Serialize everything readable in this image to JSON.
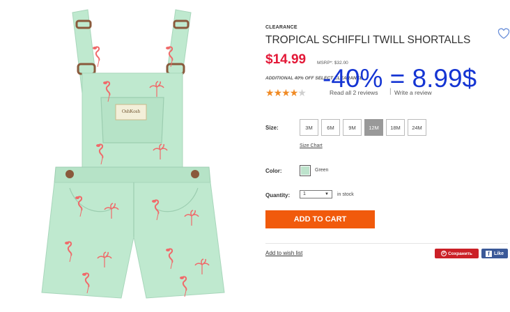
{
  "product": {
    "badge": "CLEARANCE",
    "title": "TROPICAL SCHIFFLI TWILL SHORTALLS",
    "price": "$14.99",
    "msrp": "MSRP*: $32.00",
    "promo": "ADDITIONAL 40% OFF SELECT CLEARANCE",
    "rating": 4.5,
    "stars_text": "★★★★★",
    "reviews_link": "Read all 2 reviews",
    "separator": "|",
    "write_review": "Write a review"
  },
  "overlay_text": "-40% = 8.99$",
  "size": {
    "label": "Size:",
    "options": [
      "3M",
      "6M",
      "9M",
      "12M",
      "18M",
      "24M"
    ],
    "selected": "12M",
    "chart_link": "Size Chart"
  },
  "color": {
    "label": "Color:",
    "name": "Green",
    "swatch": "#bde3cc"
  },
  "quantity": {
    "label": "Quantity:",
    "value": "1",
    "stock": "in stock"
  },
  "actions": {
    "add_to_cart": "ADD TO CART",
    "wishlist": "Add to wish list",
    "save": "Сохранить",
    "like": "Like"
  },
  "colors": {
    "price_red": "#e31837",
    "cart_orange": "#f15a0c",
    "overlay_blue": "#1535d3",
    "garment_mint": "#bfe9cf",
    "print_coral": "#f06a6a"
  }
}
